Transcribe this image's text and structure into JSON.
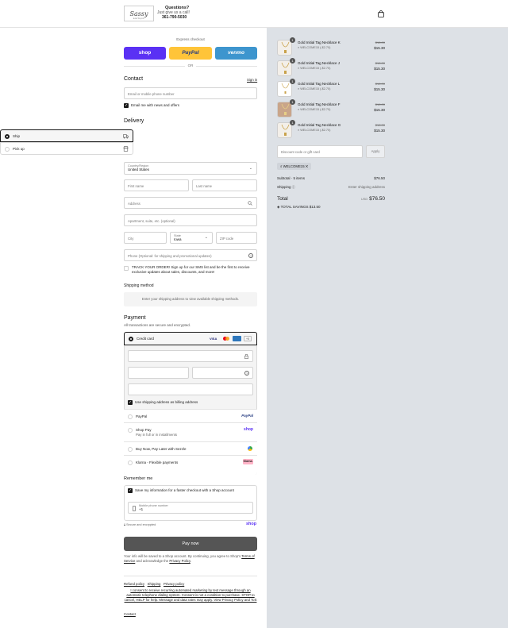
{
  "header": {
    "logo_text": "Sassy",
    "logo_sub": "BOUTIQUE",
    "questions": "Questions?",
    "give_call": "Just give us a call!",
    "phone": "361-790-5030",
    "bag_icon": "shopping-bag-icon"
  },
  "express": {
    "title": "Express checkout",
    "shop_label": "shop",
    "paypal_label": "PayPal",
    "venmo_label": "venmo",
    "or": "OR",
    "colors": {
      "shop": "#5a31f4",
      "paypal": "#ffc439",
      "venmo": "#3d95ce"
    }
  },
  "contact": {
    "title": "Contact",
    "sign_in": "Sign in",
    "email_placeholder": "Email or mobile phone number",
    "news_label": "Email me with news and offers"
  },
  "delivery": {
    "title": "Delivery",
    "ship_label": "Ship",
    "pickup_label": "Pick up",
    "country_label": "Country/Region",
    "country_value": "United States",
    "first_name": "First name",
    "last_name": "Last name",
    "address": "Address",
    "apartment": "Apartment, suite, etc. (optional)",
    "city": "City",
    "state_label": "State",
    "state_value": "Iowa",
    "zip": "ZIP code",
    "phone": "Phone (Optional: for shipping and promotional updates)",
    "sms_text": "TRACK YOUR ORDER! Sign up for our SMS list and be the first to receive exclusive updates about sales, discounts, and more!"
  },
  "shipping_method": {
    "title": "Shipping method",
    "placeholder": "Enter your shipping address to view available shipping methods."
  },
  "payment": {
    "title": "Payment",
    "subtitle": "All transactions are secure and encrypted.",
    "credit_card": "Credit card",
    "card_more": "+5",
    "billing_label": "Use shipping address as billing address",
    "paypal": "PayPal",
    "shop_pay": "Shop Pay",
    "shop_pay_sub": "Pay in full or in installments",
    "sezzle": "Buy Now, Pay Later with Sezzle",
    "klarna": "Klarna - Flexible payments",
    "klarna_badge": "Klarna.",
    "paypal_badge": "PayPal",
    "shop_badge": "shop"
  },
  "remember": {
    "title": "Remember me",
    "save_label": "Save my information for a faster checkout with a Shop account",
    "mobile_label": "Mobile phone number",
    "mobile_value": "+1",
    "secure": "Secure and encrypted",
    "shop_logo": "shop"
  },
  "pay_button": "Pay now",
  "legal": {
    "text_pre": "Your info will be saved to a Shop account. By continuing, you agree to Shop's",
    "terms": "Terms of Service",
    "and_ack": "and acknowledge the",
    "privacy": "Privacy Policy"
  },
  "footer": {
    "refund": "Refund policy",
    "shipping": "Shipping",
    "privacy": "Privacy policy",
    "consent": "I consent to receive recurring automated marketing by text message through an automatic telephone dialing system. Consent is not a condition to purchase. STOP to cancel, HELP for help. Message and data rates may apply. View Privacy Policy and ToS",
    "contact": "Contact"
  },
  "cart": {
    "items": [
      {
        "name": "Gold Initial Tag Necklace K",
        "discount": "WELCOME15 (-$2.70)",
        "old": "$18.00",
        "new": "$15.30",
        "qty": "1"
      },
      {
        "name": "Gold Initial Tag Necklace J",
        "discount": "WELCOME15 (-$2.70)",
        "old": "$18.00",
        "new": "$15.30",
        "qty": "1"
      },
      {
        "name": "Gold Initial Tag Necklace L",
        "discount": "WELCOME15 (-$2.70)",
        "old": "$18.00",
        "new": "$15.30",
        "qty": "1"
      },
      {
        "name": "Gold Initial Tag Necklace F",
        "discount": "WELCOME15 (-$2.70)",
        "old": "$18.00",
        "new": "$15.30",
        "qty": "1"
      },
      {
        "name": "Gold Initial Tag Necklace G",
        "discount": "WELCOME15 (-$2.70)",
        "old": "$18.00",
        "new": "$15.30",
        "qty": "1"
      }
    ],
    "discount_placeholder": "Discount code or gift card",
    "apply": "Apply",
    "code_tag": "WELCOME15",
    "subtotal_label": "Subtotal · 5 items",
    "subtotal_value": "$76.50",
    "shipping_label": "Shipping",
    "shipping_value": "Enter shipping address",
    "total_label": "Total",
    "currency": "USD",
    "total_value": "$76.50",
    "savings_label": "TOTAL SAVINGS",
    "savings_value": "$13.50"
  }
}
